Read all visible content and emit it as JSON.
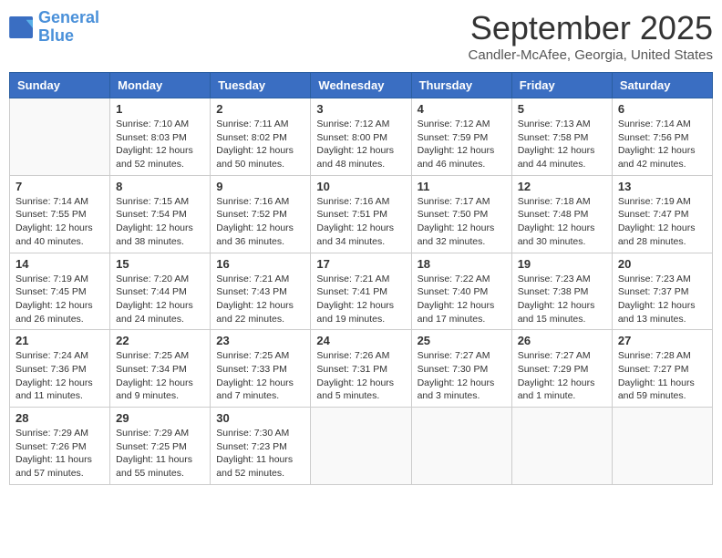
{
  "logo": {
    "line1": "General",
    "line2": "Blue"
  },
  "title": "September 2025",
  "location": "Candler-McAfee, Georgia, United States",
  "weekdays": [
    "Sunday",
    "Monday",
    "Tuesday",
    "Wednesday",
    "Thursday",
    "Friday",
    "Saturday"
  ],
  "weeks": [
    [
      {
        "day": "",
        "info": ""
      },
      {
        "day": "1",
        "info": "Sunrise: 7:10 AM\nSunset: 8:03 PM\nDaylight: 12 hours\nand 52 minutes."
      },
      {
        "day": "2",
        "info": "Sunrise: 7:11 AM\nSunset: 8:02 PM\nDaylight: 12 hours\nand 50 minutes."
      },
      {
        "day": "3",
        "info": "Sunrise: 7:12 AM\nSunset: 8:00 PM\nDaylight: 12 hours\nand 48 minutes."
      },
      {
        "day": "4",
        "info": "Sunrise: 7:12 AM\nSunset: 7:59 PM\nDaylight: 12 hours\nand 46 minutes."
      },
      {
        "day": "5",
        "info": "Sunrise: 7:13 AM\nSunset: 7:58 PM\nDaylight: 12 hours\nand 44 minutes."
      },
      {
        "day": "6",
        "info": "Sunrise: 7:14 AM\nSunset: 7:56 PM\nDaylight: 12 hours\nand 42 minutes."
      }
    ],
    [
      {
        "day": "7",
        "info": "Sunrise: 7:14 AM\nSunset: 7:55 PM\nDaylight: 12 hours\nand 40 minutes."
      },
      {
        "day": "8",
        "info": "Sunrise: 7:15 AM\nSunset: 7:54 PM\nDaylight: 12 hours\nand 38 minutes."
      },
      {
        "day": "9",
        "info": "Sunrise: 7:16 AM\nSunset: 7:52 PM\nDaylight: 12 hours\nand 36 minutes."
      },
      {
        "day": "10",
        "info": "Sunrise: 7:16 AM\nSunset: 7:51 PM\nDaylight: 12 hours\nand 34 minutes."
      },
      {
        "day": "11",
        "info": "Sunrise: 7:17 AM\nSunset: 7:50 PM\nDaylight: 12 hours\nand 32 minutes."
      },
      {
        "day": "12",
        "info": "Sunrise: 7:18 AM\nSunset: 7:48 PM\nDaylight: 12 hours\nand 30 minutes."
      },
      {
        "day": "13",
        "info": "Sunrise: 7:19 AM\nSunset: 7:47 PM\nDaylight: 12 hours\nand 28 minutes."
      }
    ],
    [
      {
        "day": "14",
        "info": "Sunrise: 7:19 AM\nSunset: 7:45 PM\nDaylight: 12 hours\nand 26 minutes."
      },
      {
        "day": "15",
        "info": "Sunrise: 7:20 AM\nSunset: 7:44 PM\nDaylight: 12 hours\nand 24 minutes."
      },
      {
        "day": "16",
        "info": "Sunrise: 7:21 AM\nSunset: 7:43 PM\nDaylight: 12 hours\nand 22 minutes."
      },
      {
        "day": "17",
        "info": "Sunrise: 7:21 AM\nSunset: 7:41 PM\nDaylight: 12 hours\nand 19 minutes."
      },
      {
        "day": "18",
        "info": "Sunrise: 7:22 AM\nSunset: 7:40 PM\nDaylight: 12 hours\nand 17 minutes."
      },
      {
        "day": "19",
        "info": "Sunrise: 7:23 AM\nSunset: 7:38 PM\nDaylight: 12 hours\nand 15 minutes."
      },
      {
        "day": "20",
        "info": "Sunrise: 7:23 AM\nSunset: 7:37 PM\nDaylight: 12 hours\nand 13 minutes."
      }
    ],
    [
      {
        "day": "21",
        "info": "Sunrise: 7:24 AM\nSunset: 7:36 PM\nDaylight: 12 hours\nand 11 minutes."
      },
      {
        "day": "22",
        "info": "Sunrise: 7:25 AM\nSunset: 7:34 PM\nDaylight: 12 hours\nand 9 minutes."
      },
      {
        "day": "23",
        "info": "Sunrise: 7:25 AM\nSunset: 7:33 PM\nDaylight: 12 hours\nand 7 minutes."
      },
      {
        "day": "24",
        "info": "Sunrise: 7:26 AM\nSunset: 7:31 PM\nDaylight: 12 hours\nand 5 minutes."
      },
      {
        "day": "25",
        "info": "Sunrise: 7:27 AM\nSunset: 7:30 PM\nDaylight: 12 hours\nand 3 minutes."
      },
      {
        "day": "26",
        "info": "Sunrise: 7:27 AM\nSunset: 7:29 PM\nDaylight: 12 hours\nand 1 minute."
      },
      {
        "day": "27",
        "info": "Sunrise: 7:28 AM\nSunset: 7:27 PM\nDaylight: 11 hours\nand 59 minutes."
      }
    ],
    [
      {
        "day": "28",
        "info": "Sunrise: 7:29 AM\nSunset: 7:26 PM\nDaylight: 11 hours\nand 57 minutes."
      },
      {
        "day": "29",
        "info": "Sunrise: 7:29 AM\nSunset: 7:25 PM\nDaylight: 11 hours\nand 55 minutes."
      },
      {
        "day": "30",
        "info": "Sunrise: 7:30 AM\nSunset: 7:23 PM\nDaylight: 11 hours\nand 52 minutes."
      },
      {
        "day": "",
        "info": ""
      },
      {
        "day": "",
        "info": ""
      },
      {
        "day": "",
        "info": ""
      },
      {
        "day": "",
        "info": ""
      }
    ]
  ]
}
